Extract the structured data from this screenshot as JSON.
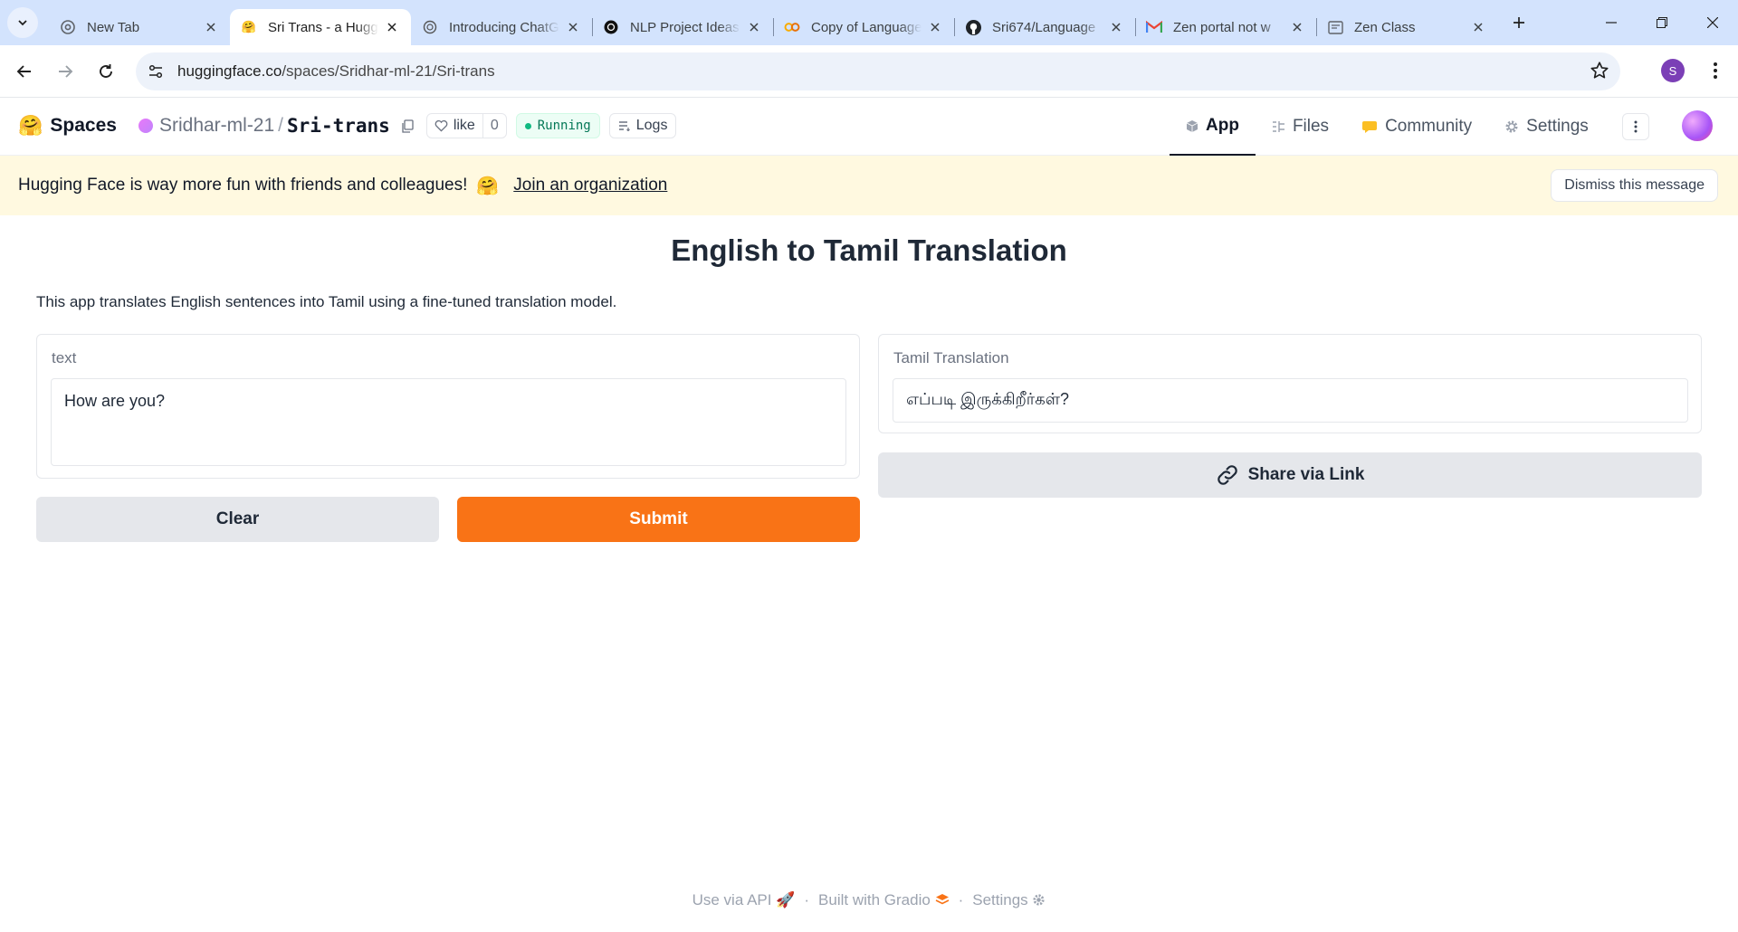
{
  "browser": {
    "tabs": [
      {
        "title": "New Tab",
        "icon": "chrome-icon",
        "active": false
      },
      {
        "title": "Sri Trans - a Hugging Face Space",
        "icon": "hugging-face-icon",
        "active": true
      },
      {
        "title": "Introducing ChatGPT",
        "icon": "openai-icon",
        "active": false
      },
      {
        "title": "NLP Project Ideas",
        "icon": "openai-icon",
        "active": false
      },
      {
        "title": "Copy of Language",
        "icon": "colab-icon",
        "active": false
      },
      {
        "title": "Sri674/Language",
        "icon": "github-icon",
        "active": false
      },
      {
        "title": "Zen portal not w",
        "icon": "gmail-icon",
        "active": false
      },
      {
        "title": "Zen Class",
        "icon": "page-icon",
        "active": false
      }
    ],
    "url_host": "huggingface.co",
    "url_path": "/spaces/Sridhar-ml-21/Sri-trans",
    "profile_initial": "S"
  },
  "hf": {
    "brand": "Spaces",
    "owner": "Sridhar-ml-21",
    "slash": "/",
    "repo": "Sri-trans",
    "like_label": "like",
    "like_count": "0",
    "status": "Running",
    "logs_label": "Logs",
    "nav": {
      "app": "App",
      "files": "Files",
      "community": "Community",
      "settings": "Settings"
    }
  },
  "banner": {
    "message": "Hugging Face is way more fun with friends and colleagues!",
    "emoji": "🤗",
    "link": "Join an organization",
    "dismiss": "Dismiss this message"
  },
  "app": {
    "title": "English to Tamil Translation",
    "description": "This app translates English sentences into Tamil using a fine-tuned translation model.",
    "input_label": "text",
    "input_value": "How are you?",
    "output_label": "Tamil Translation",
    "output_value": "எப்படி இருக்கிறீர்கள்?",
    "clear_label": "Clear",
    "submit_label": "Submit",
    "share_label": "Share via Link"
  },
  "footer": {
    "api": "Use via API",
    "sep": "·",
    "built": "Built with Gradio",
    "settings": "Settings"
  },
  "colors": {
    "tabstrip": "#d3e3fd",
    "submit": "#f97316",
    "banner": "#fff9e0",
    "running": "#047857"
  }
}
